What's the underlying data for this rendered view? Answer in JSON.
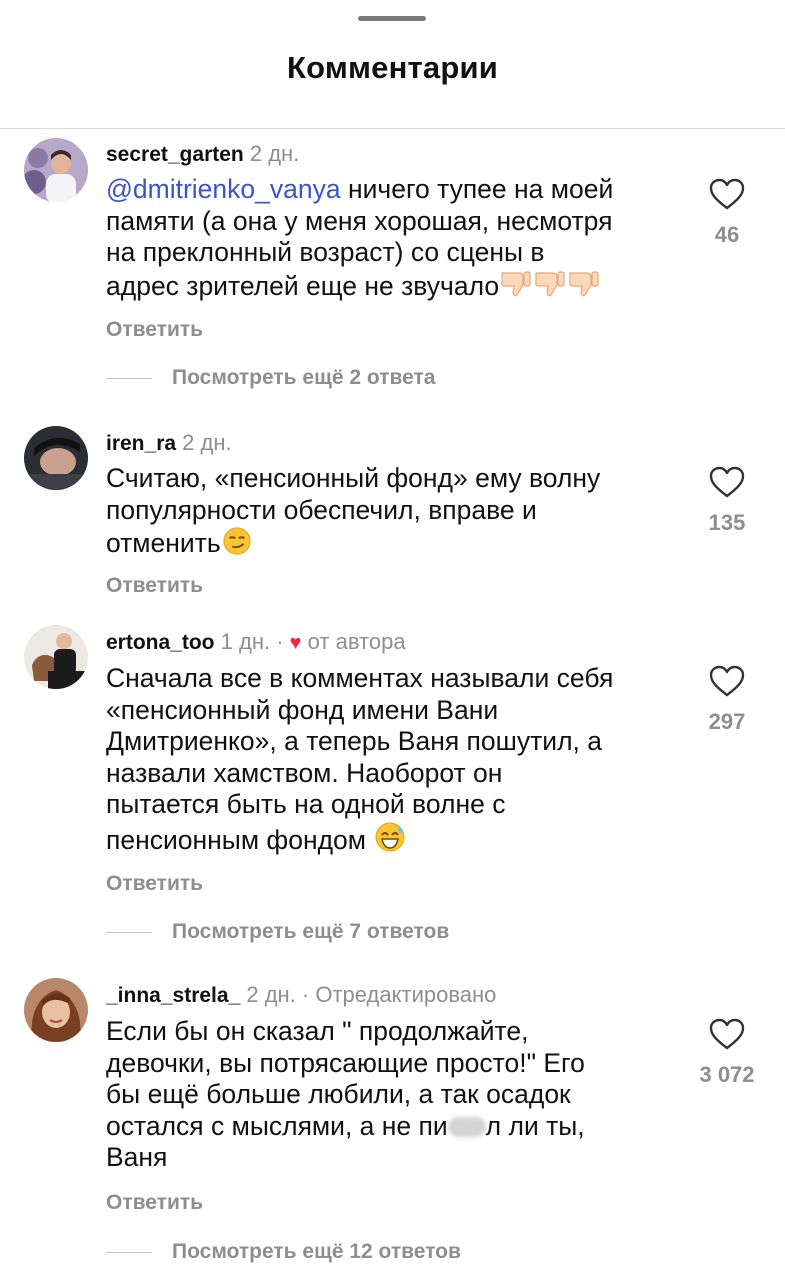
{
  "header": {
    "title": "Комментарии"
  },
  "comments": [
    {
      "user": "secret_garten",
      "time": "2 дн.",
      "mention": "@dmitrienko_vanya",
      "text_lines": [
        "ничего тупее на моей",
        "памяти (а она у меня хорошая, несмотря",
        "на преклонный возраст) со сцены в",
        "адрес зрителей еще не звучало"
      ],
      "emojis": [
        "thumbs-down-emoji",
        "thumbs-down-emoji",
        "thumbs-down-emoji"
      ],
      "likes": "46",
      "reply_label": "Ответить",
      "more_replies": "Посмотреть ещё 2 ответа"
    },
    {
      "user": "iren_ra",
      "time": "2 дн.",
      "text_lines": [
        "Считаю, «пенсионный фонд» ему волну",
        "популярности обеспечил, вправе и",
        "отменить"
      ],
      "emojis": [
        "smirking-face-emoji"
      ],
      "likes": "135",
      "reply_label": "Ответить"
    },
    {
      "user": "ertona_too",
      "time": "1 дн. ·",
      "author_like": "от автора",
      "text_lines": [
        "Сначала все в комментах называли себя",
        "«пенсионный фонд имени Вани",
        "Дмитриенко», а теперь Ваня пошутил, а",
        "назвали хамством. Наоборот он",
        "пытается быть на одной волне с",
        "пенсионным фондом"
      ],
      "emojis": [
        "grinning-sweat-emoji"
      ],
      "likes": "297",
      "reply_label": "Ответить",
      "more_replies": "Посмотреть ещё 7 ответов"
    },
    {
      "user": "_inna_strela_",
      "time": "2 дн. · Отредактировано",
      "text_lines": [
        "Если бы он сказал \" продолжайте,",
        "девочки, вы потрясающие просто!\" Его",
        "бы ещё больше любили, а так осадок",
        "остался с мыслями, а не пи",
        "л ли ты,",
        "Ваня"
      ],
      "likes": "3 072",
      "reply_label": "Ответить",
      "more_replies": "Посмотреть ещё 12 ответов"
    }
  ]
}
